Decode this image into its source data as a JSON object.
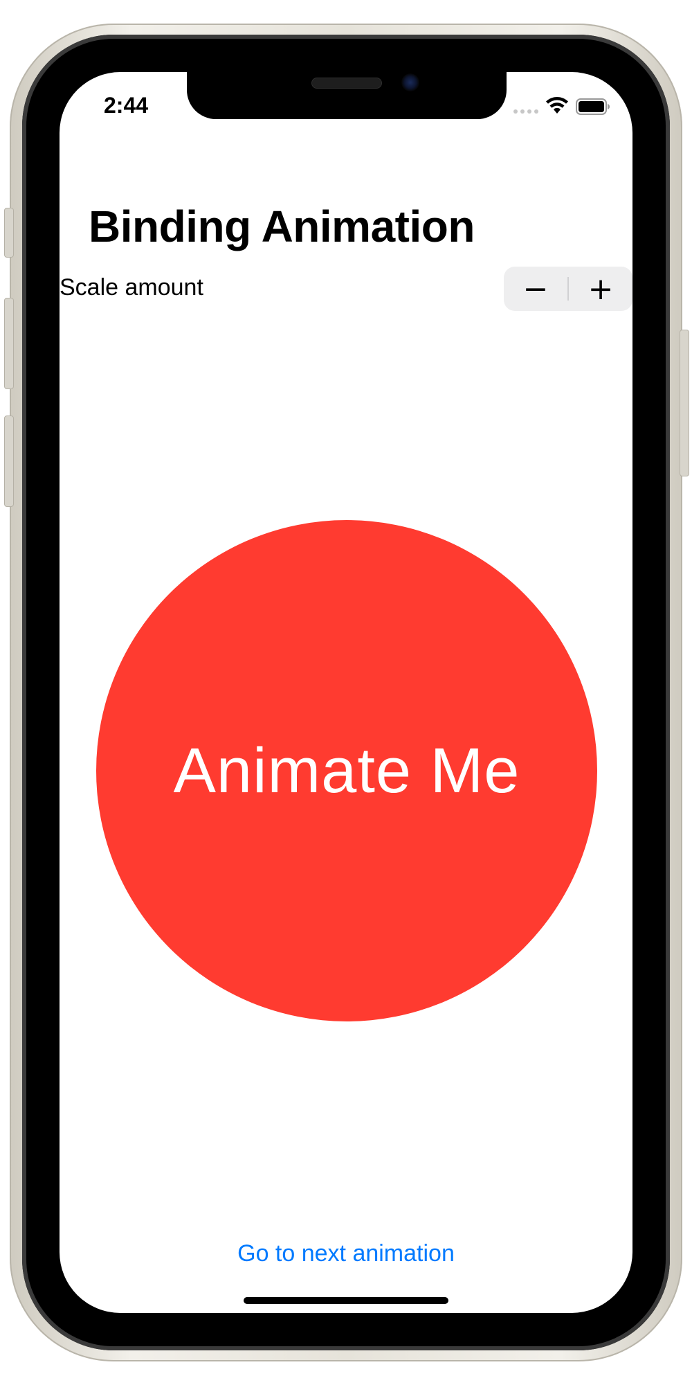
{
  "status_bar": {
    "time": "2:44",
    "signal_icon": "cellular-dots-icon",
    "wifi_icon": "wifi-icon",
    "battery_icon": "battery-full-icon"
  },
  "navigation": {
    "title": "Binding Animation"
  },
  "stepper": {
    "label": "Scale amount",
    "decrement_label": "−",
    "increment_label": "+"
  },
  "animate_button": {
    "label": "Animate Me",
    "color": "#ff3b30"
  },
  "footer": {
    "link_label": "Go to next animation",
    "link_color": "#007aff"
  }
}
